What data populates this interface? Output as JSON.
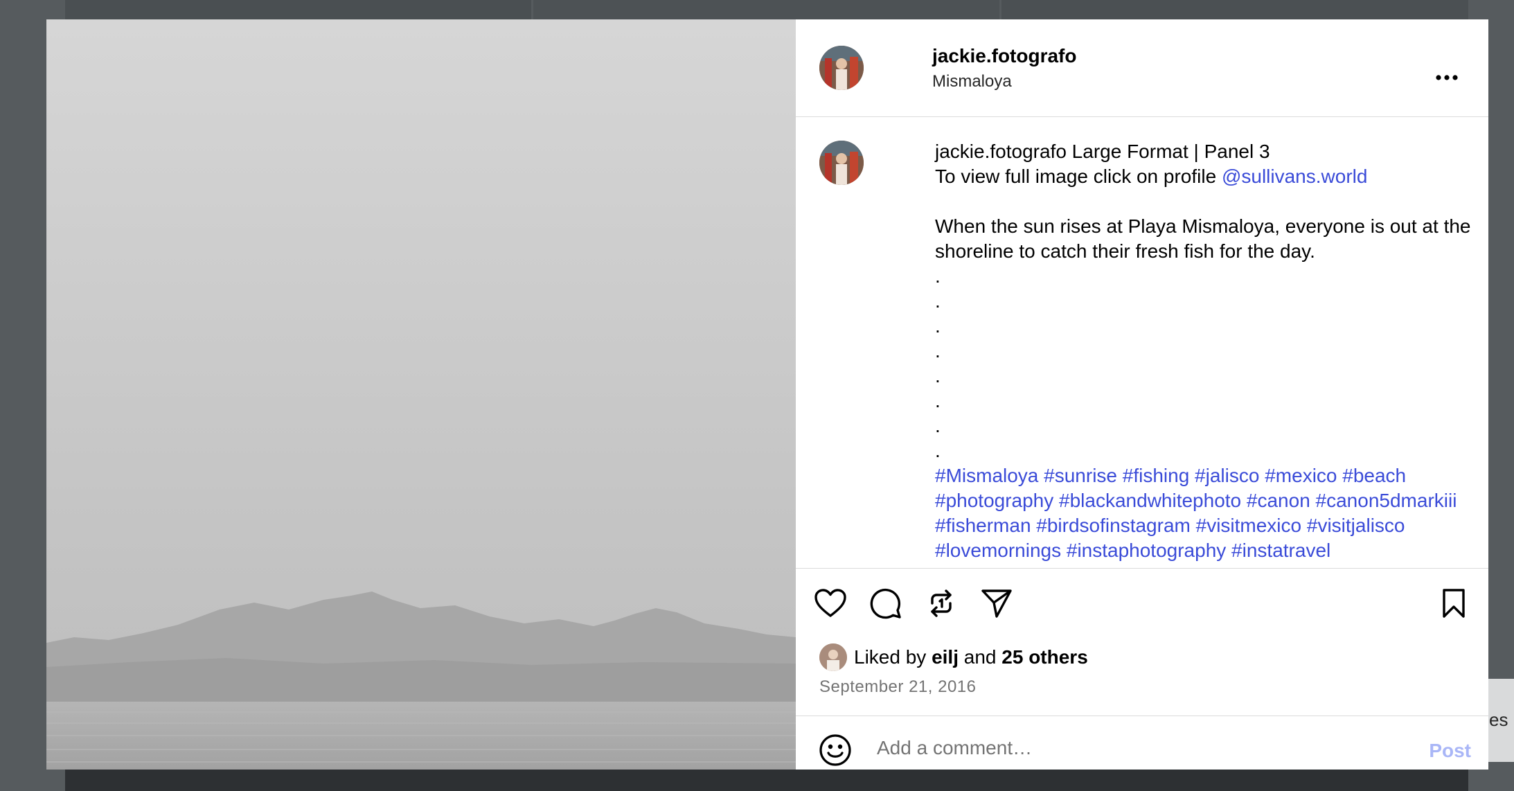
{
  "background": {
    "side_text": "es"
  },
  "post": {
    "username": "jackie.fotografo",
    "location": "Mismaloya",
    "more_icon": "more-horizontal-icon"
  },
  "caption": {
    "username": "jackie.fotografo",
    "title": "Large Format | Panel 3",
    "line2_prefix": "To view full image click on profile",
    "mention": "@sullivans.world",
    "paragraph_line1": "When the sun rises at Playa Mismaloya, everyone is out at the",
    "paragraph_line2": "shoreline to catch their fresh fish for the day.",
    "dots": [
      ".",
      ".",
      ".",
      ".",
      ".",
      ".",
      ".",
      "."
    ],
    "hashtag_lines": [
      "#Mismaloya #sunrise #fishing #jalisco #mexico #beach",
      "#photography #blackandwhitephoto #canon #canon5dmarkiii",
      "#fisherman #birdsofinstagram #visitmexico #visitjalisco",
      "#lovemornings #instaphotography #instatravel"
    ]
  },
  "actions": {
    "like_icon": "heart-icon",
    "comment_icon": "comment-icon",
    "repost_icon": "repost-icon",
    "share_icon": "share-icon",
    "save_icon": "bookmark-icon"
  },
  "likes": {
    "prefix": "Liked by",
    "user": "eilj",
    "middle": "and",
    "others": "25 others"
  },
  "date": "September 21, 2016",
  "comment": {
    "placeholder": "Add a comment…",
    "post_label": "Post",
    "emoji_icon": "emoji-icon"
  },
  "colors": {
    "link": "#3a4bd8",
    "post_button_disabled": "#a9b6f7",
    "overlay": "#565b5e"
  }
}
